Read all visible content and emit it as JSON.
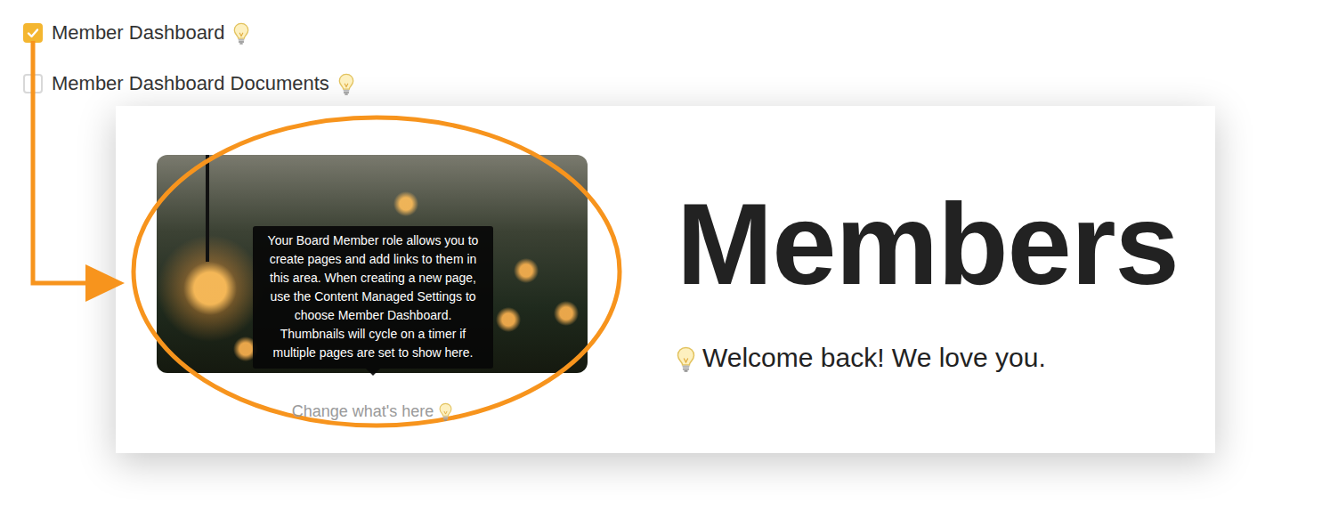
{
  "checklist": [
    {
      "label": "Member Dashboard",
      "checked": true
    },
    {
      "label": "Member Dashboard Documents",
      "checked": false
    }
  ],
  "dashboard": {
    "tooltip": "Your Board Member role allows you to create pages and add links to them in this area. When creating a new page, use the Content Managed Settings to choose Member Dashboard. Thumbnails will cycle on a timer if multiple pages are set to show here.",
    "change_link": "Change what's here",
    "title": "Members",
    "welcome": "Welcome back! We love you."
  }
}
